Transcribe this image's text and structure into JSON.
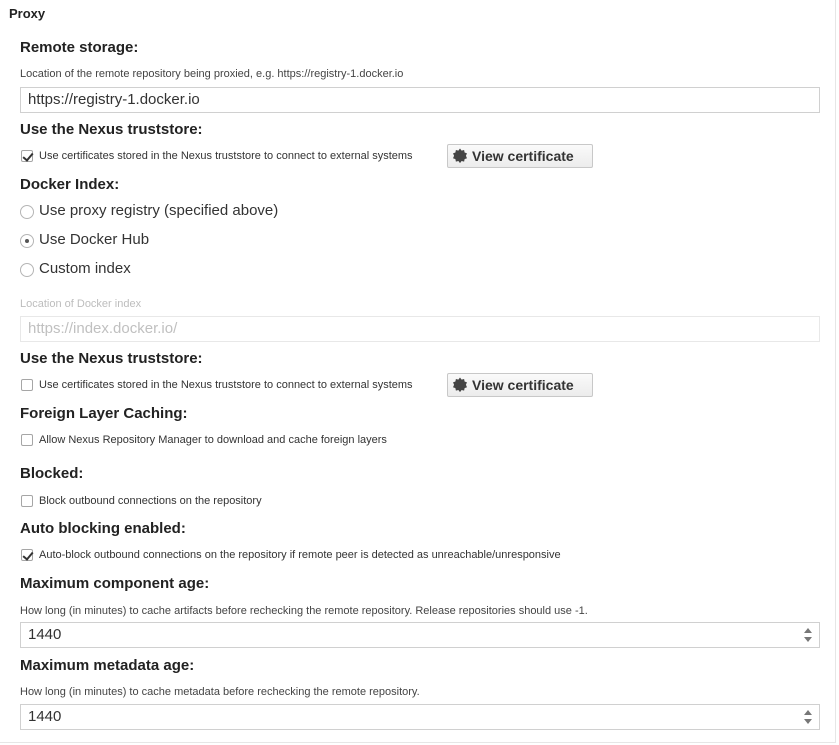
{
  "section": {
    "title": "Proxy"
  },
  "remote_storage": {
    "label": "Remote storage:",
    "help": "Location of the remote repository being proxied, e.g. https://registry-1.docker.io",
    "value": "https://registry-1.docker.io"
  },
  "truststore1": {
    "label": "Use the Nexus truststore:",
    "checkbox_label": "Use certificates stored in the Nexus truststore to connect to external systems",
    "checked": true,
    "button_label": "View certificate"
  },
  "docker_index": {
    "label": "Docker Index:",
    "options": [
      {
        "label": "Use proxy registry (specified above)",
        "selected": false
      },
      {
        "label": "Use Docker Hub",
        "selected": true
      },
      {
        "label": "Custom index",
        "selected": false
      }
    ],
    "location_help": "Location of Docker index",
    "location_placeholder": "https://index.docker.io/"
  },
  "truststore2": {
    "label": "Use the Nexus truststore:",
    "checkbox_label": "Use certificates stored in the Nexus truststore to connect to external systems",
    "checked": false,
    "button_label": "View certificate"
  },
  "foreign_layer": {
    "label": "Foreign Layer Caching:",
    "checkbox_label": "Allow Nexus Repository Manager to download and cache foreign layers",
    "checked": false
  },
  "blocked": {
    "label": "Blocked:",
    "checkbox_label": "Block outbound connections on the repository",
    "checked": false
  },
  "auto_blocking": {
    "label": "Auto blocking enabled:",
    "checkbox_label": "Auto-block outbound connections on the repository if remote peer is detected as unreachable/unresponsive",
    "checked": true
  },
  "max_component_age": {
    "label": "Maximum component age:",
    "help": "How long (in minutes) to cache artifacts before rechecking the remote repository. Release repositories should use -1.",
    "value": "1440"
  },
  "max_metadata_age": {
    "label": "Maximum metadata age:",
    "help": "How long (in minutes) to cache metadata before rechecking the remote repository.",
    "value": "1440"
  }
}
